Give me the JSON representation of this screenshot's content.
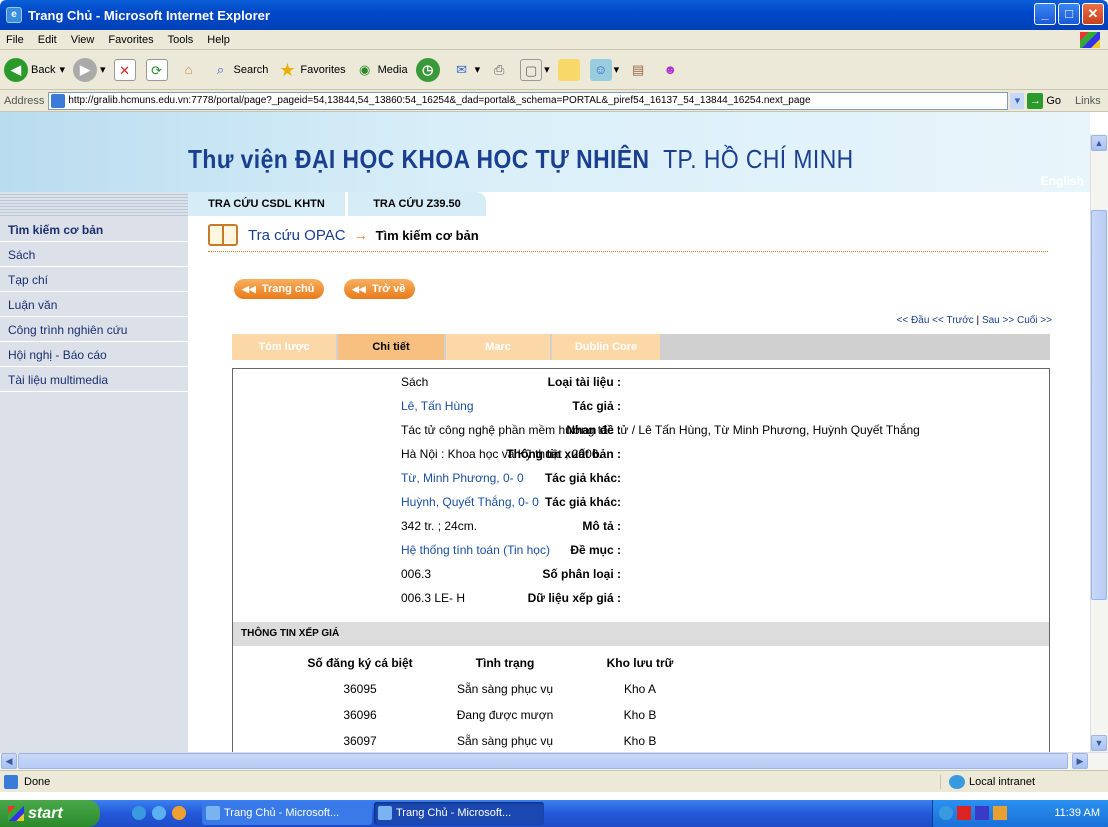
{
  "window": {
    "title": "Trang Chủ - Microsoft Internet Explorer"
  },
  "menu": [
    "File",
    "Edit",
    "View",
    "Favorites",
    "Tools",
    "Help"
  ],
  "toolbar": {
    "back": "Back",
    "search": "Search",
    "favorites": "Favorites",
    "media": "Media"
  },
  "address": {
    "label": "Address",
    "url": "http://gralib.hcmuns.edu.vn:7778/portal/page?_pageid=54,13844,54_13860:54_16254&_dad=portal&_schema=PORTAL&_piref54_16137_54_13844_16254.next_page",
    "go": "Go",
    "links": "Links"
  },
  "banner": {
    "title_prefix": "Thư viện ĐẠI HỌC KHOA HỌC TỰ NHIÊN",
    "title_suffix": "TP. HỒ CHÍ MINH",
    "english": "English"
  },
  "top_tabs": [
    "TRA CỨU CSDL KHTN",
    "TRA CỨU Z39.50"
  ],
  "sidebar": {
    "items": [
      "Tìm kiếm cơ bản",
      "Sách",
      "Tạp chí",
      "Luận văn",
      "Công trình nghiên cứu",
      "Hội nghị - Báo cáo",
      "Tài liệu multimedia"
    ]
  },
  "breadcrumb": {
    "root": "Tra cứu OPAC",
    "arrow": "→",
    "current": "Tìm kiếm cơ bản"
  },
  "buttons": {
    "home": "Trang chủ",
    "back": "Trở về"
  },
  "pager": {
    "first_prev": "<< Đầu << Trước",
    "sep": " | ",
    "next_last": "Sau >> Cuối >>"
  },
  "detail_tabs": [
    "Tóm lược",
    "Chi tiết",
    "Marc",
    "Dublin Core"
  ],
  "fields": [
    {
      "label": "Loại tài liệu :",
      "value": "Sách",
      "link": false
    },
    {
      "label": "Tác giả :",
      "value": "Lê, Tấn Hùng",
      "link": true
    },
    {
      "label": "Nhan đề :",
      "value": "Tác tử công nghệ phần mềm hướng tác tử / Lê Tấn Hùng, Từ Minh Phương, Huỳnh Quyết Thắng",
      "link": false
    },
    {
      "label": "Thông tin xuất bản :",
      "value": "Hà Nội : Khoa học và Kỹ thuật , 2006.",
      "link": false
    },
    {
      "label": "Tác giả khác:",
      "value": "Từ, Minh Phương, 0- 0",
      "link": true
    },
    {
      "label": "Tác giả khác:",
      "value": "Huỳnh, Quyết Thắng, 0- 0",
      "link": true
    },
    {
      "label": "Mô tả :",
      "value": "342 tr. ; 24cm.",
      "link": false
    },
    {
      "label": "Đề mục :",
      "value": "Hệ thống tính toán (Tin học)",
      "link": true
    },
    {
      "label": "Số phân loại :",
      "value": "006.3",
      "link": false
    },
    {
      "label": "Dữ liệu xếp giá :",
      "value": "006.3  LE- H",
      "link": false
    }
  ],
  "holdings": {
    "header": "THÔNG TIN XẾP GIÁ",
    "columns": [
      "Số đăng ký cá biệt",
      "Tình trạng",
      "Kho lưu trữ"
    ],
    "rows": [
      [
        "36095",
        "Sẵn sàng phục vụ",
        "Kho A"
      ],
      [
        "36096",
        "Đang được mượn",
        "Kho B"
      ],
      [
        "36097",
        "Sẵn sàng phục vụ",
        "Kho B"
      ]
    ]
  },
  "status": {
    "text": "Done",
    "zone": "Local intranet"
  },
  "taskbar": {
    "start": "start",
    "tasks": [
      "Trang Chủ - Microsoft...",
      "Trang Chủ - Microsoft..."
    ],
    "clock": "11:39 AM"
  }
}
